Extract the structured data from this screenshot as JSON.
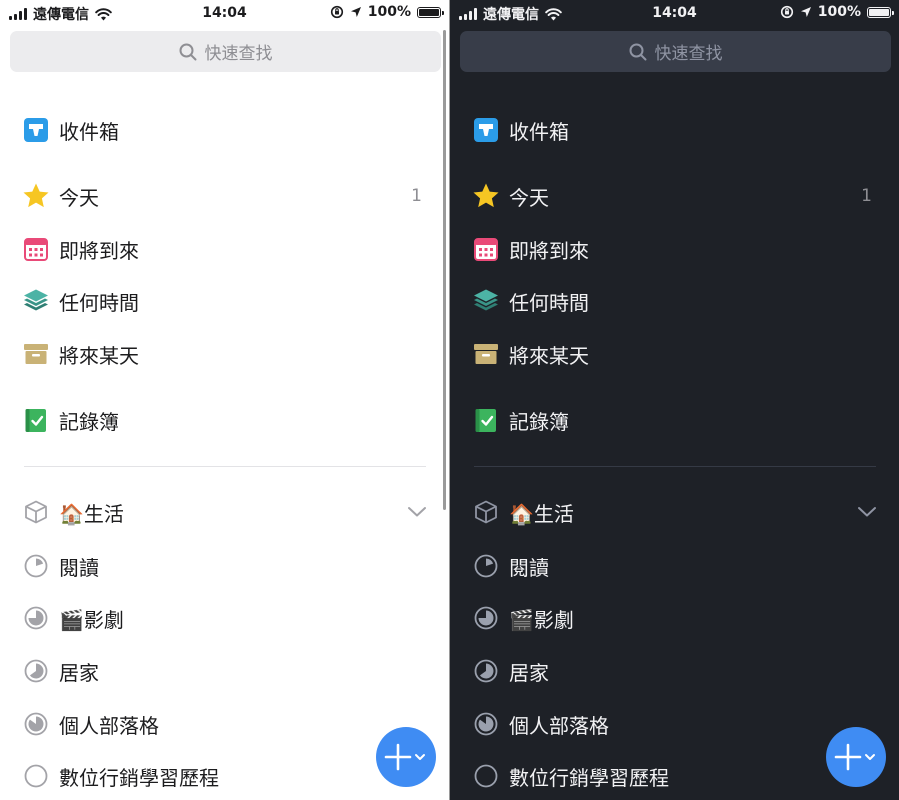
{
  "status_bar": {
    "carrier": "遠傳電信",
    "time": "14:04",
    "battery": "100%"
  },
  "search": {
    "placeholder": "快速查找"
  },
  "nav": {
    "inbox": {
      "label": "收件箱",
      "icon": "inbox-icon"
    },
    "today": {
      "label": "今天",
      "count": "1",
      "icon": "star-icon"
    },
    "upcoming": {
      "label": "即將到來",
      "icon": "calendar-icon"
    },
    "anytime": {
      "label": "任何時間",
      "icon": "layers-icon"
    },
    "someday": {
      "label": "將來某天",
      "icon": "archive-box-icon"
    },
    "logbook": {
      "label": "記錄簿",
      "icon": "logbook-icon"
    }
  },
  "area": {
    "label": "🏠生活",
    "icon": "area-cube-icon"
  },
  "projects": [
    {
      "label": "閱讀",
      "progress": 0.2
    },
    {
      "label": "🎬影劇",
      "progress": 0.75
    },
    {
      "label": "居家",
      "progress": 0.65
    },
    {
      "label": "個人部落格",
      "progress": 0.85
    },
    {
      "label": "數位行銷學習歷程",
      "progress": 0
    }
  ],
  "colors": {
    "accent": "#3f8cf3",
    "inbox": "#2b9ce8",
    "today": "#f6c623",
    "upcoming": "#e94a78",
    "anytime": "#43a89c",
    "someday": "#c9b276",
    "logbook": "#3cb45e",
    "light_bg": "#ffffff",
    "dark_bg": "#1e2127"
  }
}
